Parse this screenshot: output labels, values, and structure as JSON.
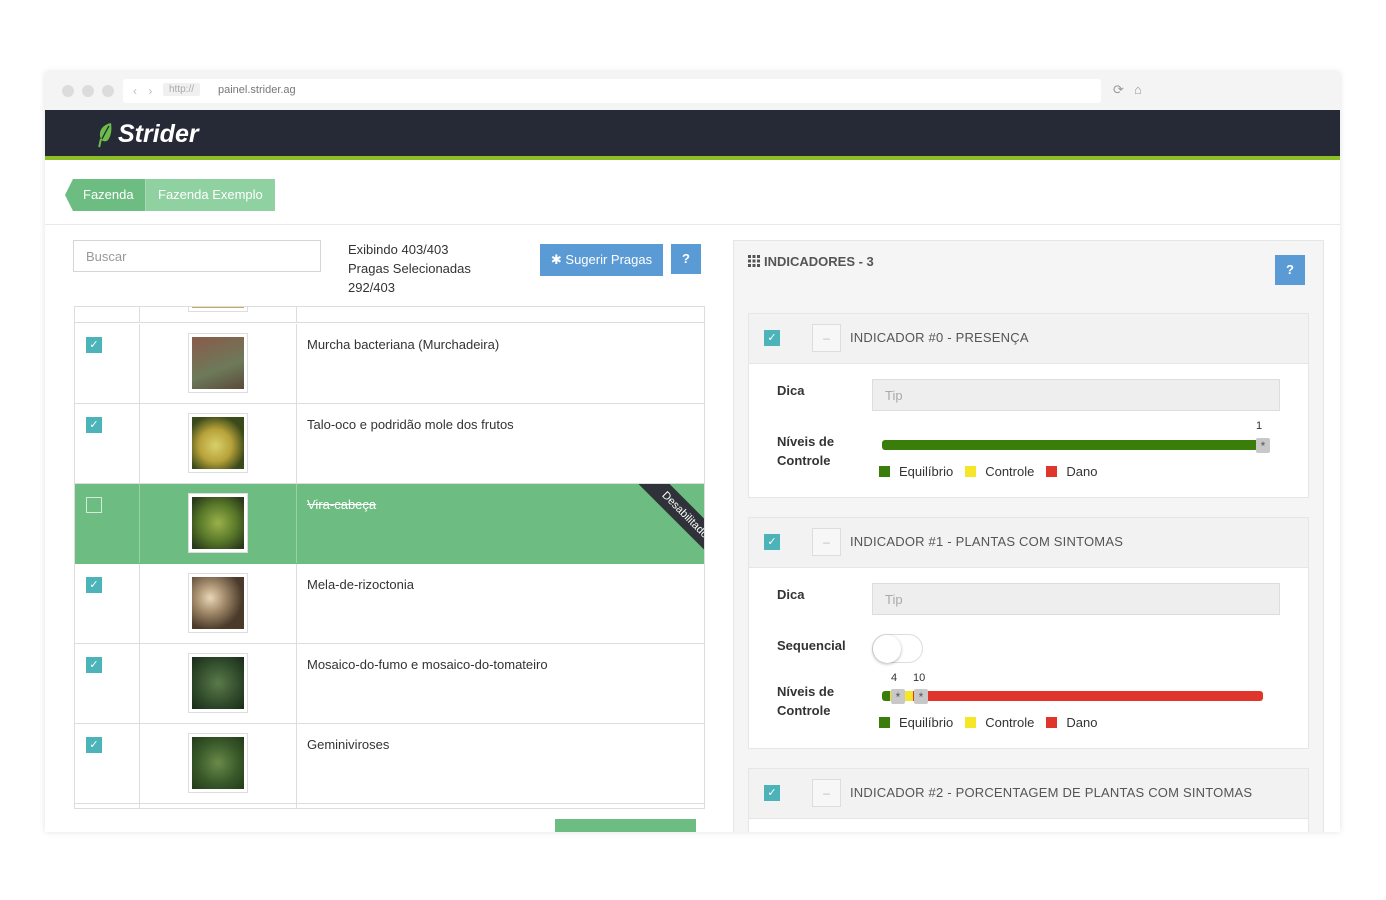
{
  "browser": {
    "nav": "‹ ›",
    "protocol": "http://",
    "host": "painel.strider.ag"
  },
  "app": {
    "brand": "Strider",
    "accent": "#8cbf26",
    "header_bg": "#262a36"
  },
  "breadcrumb": [
    "Fazenda",
    "Fazenda Exemplo"
  ],
  "pests": {
    "search_placeholder": "Buscar",
    "showing": "Exibindo 403/403",
    "selected_label": "Pragas Selecionadas",
    "selected_count": "292/403",
    "suggest_button": "Sugerir Pragas",
    "help_button": "?",
    "disabled_ribbon": "Desabilitado",
    "rows": [
      {
        "name": "Murcha bacteriana (Murchadeira)",
        "checked": true,
        "disabled": false
      },
      {
        "name": "Talo-oco e podridão mole dos frutos",
        "checked": true,
        "disabled": false
      },
      {
        "name": "Vira-cabeça",
        "checked": false,
        "disabled": true
      },
      {
        "name": "Mela-de-rizoctonia",
        "checked": true,
        "disabled": false
      },
      {
        "name": "Mosaico-do-fumo e mosaico-do-tomateiro",
        "checked": true,
        "disabled": false
      },
      {
        "name": "Geminiviroses",
        "checked": true,
        "disabled": false
      }
    ]
  },
  "indicators": {
    "title": "INDICADORES - 3",
    "help_button": "?",
    "tip_label": "Dica",
    "tip_placeholder": "Tip",
    "levels_label_1": "Níveis de",
    "levels_label_2": "Controle",
    "sequential_label": "Sequencial",
    "legend": [
      {
        "label": "Equilíbrio",
        "color": "#3a7d0a"
      },
      {
        "label": "Controle",
        "color": "#f5e62a"
      },
      {
        "label": "Dano",
        "color": "#e0352b"
      }
    ],
    "items": [
      {
        "title": "INDICADOR #0 - PRESENÇA",
        "thresholds": [
          "1"
        ]
      },
      {
        "title": "INDICADOR #1 - PLANTAS COM SINTOMAS",
        "thresholds": [
          "4",
          "10"
        ],
        "sequential": false
      },
      {
        "title": "INDICADOR #2 - PORCENTAGEM DE PLANTAS COM SINTOMAS"
      }
    ]
  }
}
